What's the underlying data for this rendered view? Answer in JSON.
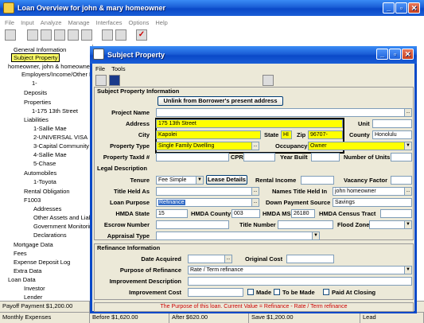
{
  "app": {
    "title": "Loan Overview for john & mary homeowner",
    "menu": [
      "File",
      "Input",
      "Analyze",
      "Manage",
      "Interfaces",
      "Options",
      "Help"
    ]
  },
  "tree": [
    {
      "label": "General Information"
    },
    {
      "label": "Subject Property"
    },
    {
      "label": "homeowner, john & homeowne"
    },
    {
      "label": "Employers/Income/Other In"
    },
    {
      "label": "1-"
    },
    {
      "label": "Deposits"
    },
    {
      "label": "Properties"
    },
    {
      "label": "1-175 13th Street"
    },
    {
      "label": "Liabilities"
    },
    {
      "label": "1-Sallie Mae"
    },
    {
      "label": "2-UNIVERSAL VISA"
    },
    {
      "label": "3-Capital Community Ba"
    },
    {
      "label": "4-Sallie Mae"
    },
    {
      "label": "5-Chase"
    },
    {
      "label": "Automobiles"
    },
    {
      "label": "1-Toyota"
    },
    {
      "label": "Rental Obligation"
    },
    {
      "label": "F1003"
    },
    {
      "label": "Addresses"
    },
    {
      "label": "Other Assets and Liab"
    },
    {
      "label": "Government Monitoring"
    },
    {
      "label": "Declarations"
    },
    {
      "label": "Mortgage Data"
    },
    {
      "label": "Fees"
    },
    {
      "label": "Expense Deposit Log"
    },
    {
      "label": "Extra Data"
    },
    {
      "label": "Loan Data"
    },
    {
      "label": "Investor"
    },
    {
      "label": "Lender"
    }
  ],
  "statusbar": {
    "row1": [
      "Payoff Payment $1,200.00"
    ],
    "row2": [
      "Monthly Expenses",
      "Before $1,620.00",
      "After $620.00",
      "Save $1,200.00",
      "Lead"
    ]
  },
  "dialog": {
    "title": "Subject Property",
    "menu": [
      "File",
      "Tools"
    ],
    "section1": "Subject Property Information",
    "section2": "Refinance Information",
    "unlink_btn": "Unlink from Borrower's present address",
    "lease_btn": "Lease Details",
    "labels": {
      "project_name": "Project Name",
      "address": "Address",
      "city": "City",
      "state": "State",
      "zip": "Zip",
      "county": "County",
      "unit": "Unit",
      "property_type": "Property Type",
      "occupancy": "Occupancy",
      "taxid": "Property TaxId #",
      "cpr": "CPR",
      "year_built": "Year Built",
      "num_units": "Number of Units",
      "legal": "Legal Description",
      "tenure": "Tenure",
      "rental_income": "Rental Income",
      "vacancy": "Vacancy Factor",
      "title_held_as": "Title Held As",
      "names_title": "Names Title Held In",
      "loan_purpose": "Loan Purpose",
      "down_payment": "Down Payment Source",
      "hmda_state": "HMDA State",
      "hmda_county": "HMDA County",
      "hmda_msa": "HMDA MSA",
      "hmda_census": "HMDA Census Tract",
      "escrow": "Escrow Number",
      "title_number": "Title Number",
      "flood": "Flood Zone",
      "appraisal": "Appraisal Type",
      "date_acquired": "Date Acquired",
      "original_cost": "Original Cost",
      "purpose_refi": "Purpose of Refinance",
      "improvement_desc": "Improvement Description",
      "improvement_cost": "Improvement Cost",
      "made": "Made",
      "to_be_made": "To be Made",
      "paid_closing": "Paid At Closing"
    },
    "values": {
      "address": "175 13th Street",
      "city": "Kapolei",
      "state": "HI",
      "zip": "96707-",
      "county": "Honolulu",
      "property_type": "Single Family Dwelling",
      "occupancy": "Owner",
      "tenure": "Fee Simple",
      "names_title": "john homeowner",
      "loan_purpose": "Refinance",
      "down_payment": "Savings",
      "hmda_state": "15",
      "hmda_county": "003",
      "hmda_msa": "26180",
      "purpose_refi": "Rate / Term refinance"
    },
    "hint": "The Purpose of this loan. Current Value = Refinance - Rate / Term refinance"
  }
}
